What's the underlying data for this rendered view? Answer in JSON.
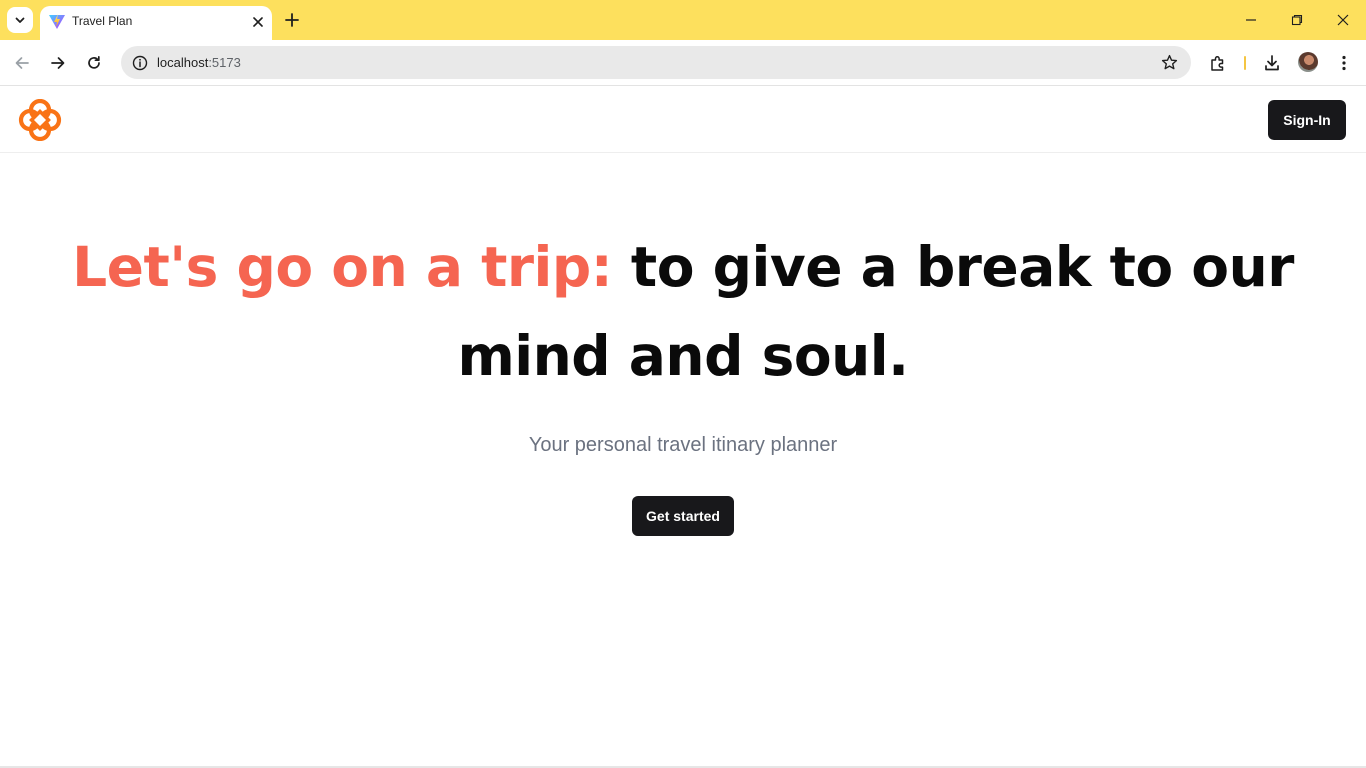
{
  "browser": {
    "tab": {
      "title": "Travel Plan",
      "favicon": "vite-logo-icon"
    },
    "url": {
      "host": "localhost",
      "port": ":5173"
    },
    "icons": [
      "tab-search-icon",
      "close-icon",
      "plus-icon",
      "minimize-icon",
      "restore-icon",
      "close-window-icon",
      "back-icon",
      "forward-icon",
      "reload-icon",
      "info-icon",
      "star-icon",
      "extensions-icon",
      "download-icon",
      "profile-avatar",
      "kebab-menu-icon"
    ],
    "colors": {
      "titlebar": "#fde05d",
      "omnibox": "#e9e9e9"
    }
  },
  "header": {
    "logo": "flower-logo-icon",
    "signin_label": "Sign-In"
  },
  "hero": {
    "title_accent": "Let's go on a trip:",
    "title_rest": " to give a break to our mind and soul.",
    "subtitle": "Your personal travel itinary planner",
    "cta_label": "Get started"
  },
  "colors": {
    "accent": "#f56551",
    "logo": "#f97316",
    "button_bg": "#18181b",
    "subtitle": "#6b7280"
  }
}
